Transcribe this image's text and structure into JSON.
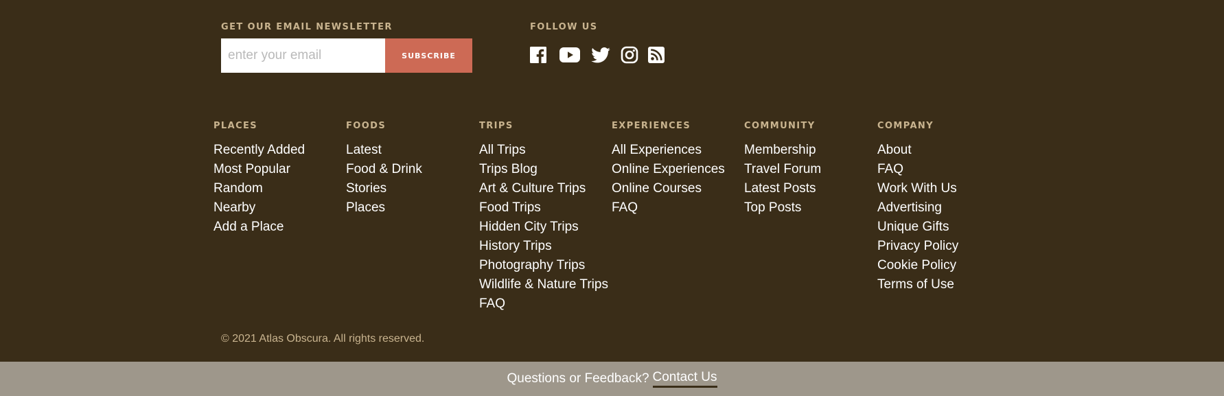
{
  "newsletter": {
    "heading": "GET OUR EMAIL NEWSLETTER",
    "email_placeholder": "enter your email",
    "email_value": "",
    "subscribe_label": "SUBSCRIBE"
  },
  "follow": {
    "heading": "FOLLOW US",
    "icons": [
      "facebook-icon",
      "youtube-icon",
      "twitter-icon",
      "instagram-icon",
      "rss-icon"
    ]
  },
  "columns": [
    {
      "heading": "PLACES",
      "links": [
        "Recently Added",
        "Most Popular",
        "Random",
        "Nearby",
        "Add a Place"
      ]
    },
    {
      "heading": "FOODS",
      "links": [
        "Latest",
        "Food & Drink",
        "Stories",
        "Places"
      ]
    },
    {
      "heading": "TRIPS",
      "links": [
        "All Trips",
        "Trips Blog",
        "Art & Culture Trips",
        "Food Trips",
        "Hidden City Trips",
        "History Trips",
        "Photography Trips",
        "Wildlife & Nature Trips",
        "FAQ"
      ]
    },
    {
      "heading": "EXPERIENCES",
      "links": [
        "All Experiences",
        "Online Experiences",
        "Online Courses",
        "FAQ"
      ]
    },
    {
      "heading": "COMMUNITY",
      "links": [
        "Membership",
        "Travel Forum",
        "Latest Posts",
        "Top Posts"
      ]
    },
    {
      "heading": "COMPANY",
      "links": [
        "About",
        "FAQ",
        "Work With Us",
        "Advertising",
        "Unique Gifts",
        "Privacy Policy",
        "Cookie Policy",
        "Terms of Use"
      ]
    }
  ],
  "copyright": "© 2021 Atlas Obscura. All rights reserved.",
  "feedback": {
    "text": "Questions or Feedback?",
    "link_label": "Contact Us"
  },
  "colors": {
    "background": "#3a2d18",
    "accent_label": "#c9b48f",
    "subscribe_button": "#cd6a55",
    "feedback_bar": "#9e978b"
  }
}
